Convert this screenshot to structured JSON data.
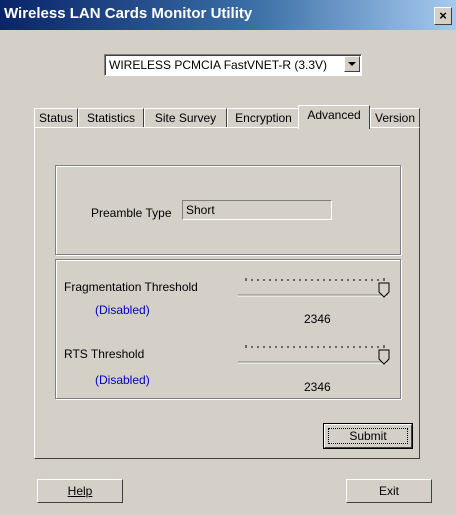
{
  "window": {
    "title": "Wireless LAN Cards Monitor Utility",
    "close_glyph": "×"
  },
  "device_select": {
    "selected": "WIRELESS PCMCIA FastVNET-R (3.3V)"
  },
  "tabs": [
    {
      "label": "Status"
    },
    {
      "label": "Statistics"
    },
    {
      "label": "Site Survey"
    },
    {
      "label": "Encryption"
    },
    {
      "label": "Advanced",
      "active": true
    },
    {
      "label": "Version"
    }
  ],
  "preamble": {
    "label": "Preamble Type",
    "value": "Short"
  },
  "fragmentation": {
    "label": "Fragmentation Threshold",
    "status": "(Disabled)",
    "value": "2346",
    "level": 1.0
  },
  "rts": {
    "label": "RTS Threshold",
    "status": "(Disabled)",
    "value": "2346",
    "level": 1.0
  },
  "buttons": {
    "submit": "Submit",
    "help": "Help",
    "exit": "Exit"
  }
}
